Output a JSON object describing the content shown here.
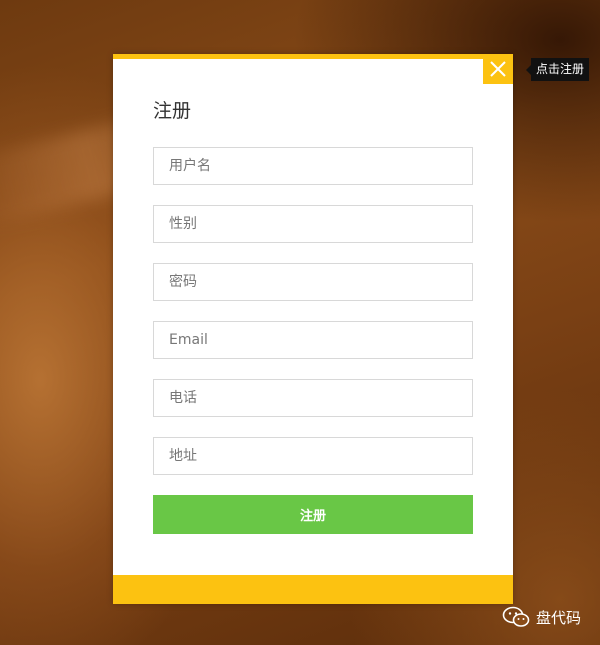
{
  "modal": {
    "title": "注册",
    "close_tooltip": "点击注册",
    "fields": [
      {
        "placeholder": "用户名"
      },
      {
        "placeholder": "性别"
      },
      {
        "placeholder": "密码"
      },
      {
        "placeholder": "Email"
      },
      {
        "placeholder": "电话"
      },
      {
        "placeholder": "地址"
      }
    ],
    "submit_label": "注册"
  },
  "watermark": {
    "label": "盘代码",
    "icon": "wechat-icon"
  },
  "colors": {
    "accent_yellow": "#fcc211",
    "submit_green": "#69c746",
    "tooltip_bg": "#111111"
  }
}
